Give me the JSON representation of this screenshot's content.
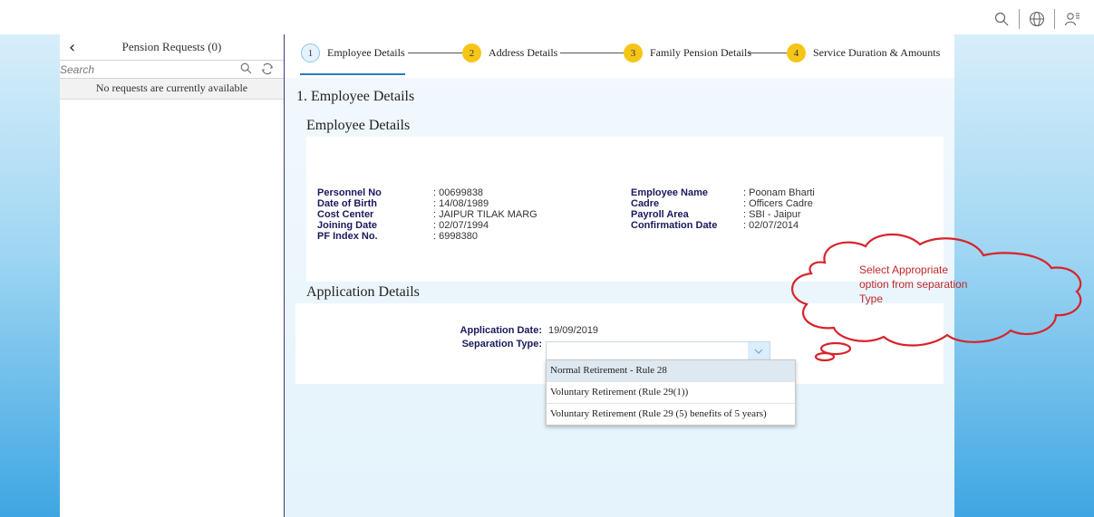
{
  "header": {
    "icons": [
      "search-icon",
      "globe-icon",
      "user-settings-icon"
    ]
  },
  "master": {
    "title": "Pension Requests (0)",
    "search_placeholder": "Search",
    "empty_text": "No requests are currently available"
  },
  "wizard": {
    "steps": [
      {
        "number": "1",
        "label": "Employee Details",
        "state": "active"
      },
      {
        "number": "2",
        "label": "Address Details",
        "state": "pending"
      },
      {
        "number": "3",
        "label": "Family Pension Details",
        "state": "pending"
      },
      {
        "number": "4",
        "label": "Service Duration & Amounts",
        "state": "pending"
      }
    ]
  },
  "section_heading": "1. Employee Details",
  "employee": {
    "title": "Employee Details",
    "left": [
      {
        "label": "Personnel No",
        "value": ": 00699838"
      },
      {
        "label": "Date of Birth",
        "value": ": 14/08/1989"
      },
      {
        "label": "Cost Center",
        "value": ": JAIPUR TILAK MARG"
      },
      {
        "label": "Joining Date",
        "value": ": 02/07/1994"
      },
      {
        "label": "PF Index No.",
        "value": ": 6998380"
      }
    ],
    "right": [
      {
        "label": "Employee Name",
        "value": ": Poonam Bharti"
      },
      {
        "label": "Cadre",
        "value": ": Officers Cadre"
      },
      {
        "label": "Payroll Area",
        "value": ": SBI - Jaipur"
      },
      {
        "label": "Confirmation Date",
        "value": ": 02/07/2014"
      }
    ]
  },
  "application": {
    "title": "Application Details",
    "date_label": "Application Date:",
    "date_value": "19/09/2019",
    "separation_label": "Separation Type:",
    "separation_value": "",
    "options": [
      "Normal Retirement - Rule 28",
      "Voluntary Retirement (Rule 29(1))",
      "Voluntary Retirement (Rule 29 (5) benefits of 5 years)"
    ]
  },
  "annotation": {
    "text_line1": "Select Appropriate",
    "text_line2": "option from separation",
    "text_line3": "Type",
    "color": "#c0282a"
  },
  "colors": {
    "accent": "#2b7bb9",
    "step_pending": "#f5c518",
    "label_navy": "#1a1a5e"
  }
}
